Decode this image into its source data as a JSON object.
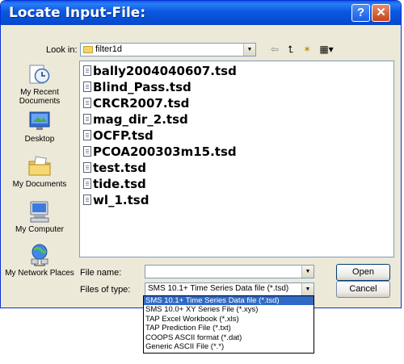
{
  "window": {
    "title": "Locate Input-File:"
  },
  "titlebar": {
    "help_glyph": "?",
    "close_glyph": "✕"
  },
  "toolbar": {
    "look_in_label": "Look in:",
    "look_in_value": "filter1d",
    "back_glyph": "⇦",
    "up_glyph": "⮤",
    "newfolder_glyph": "✶",
    "views_glyph": "▦▾"
  },
  "places": [
    {
      "label": "My Recent Documents",
      "icon": "recent-documents-icon"
    },
    {
      "label": "Desktop",
      "icon": "desktop-icon"
    },
    {
      "label": "My Documents",
      "icon": "my-documents-icon"
    },
    {
      "label": "My Computer",
      "icon": "my-computer-icon"
    },
    {
      "label": "My Network Places",
      "icon": "network-places-icon"
    }
  ],
  "files": [
    "bally2004040607.tsd",
    "Blind_Pass.tsd",
    "CRCR2007.tsd",
    "mag_dir_2.tsd",
    "OCFP.tsd",
    "PCOA200303m15.tsd",
    "test.tsd",
    "tide.tsd",
    "wl_1.tsd"
  ],
  "form": {
    "file_name_label": "File name:",
    "file_name_value": "",
    "file_type_label": "Files of type:",
    "file_type_value": "SMS 10.1+ Time Series Data file (*.tsd)"
  },
  "buttons": {
    "open": "Open",
    "cancel": "Cancel"
  },
  "filetype_options": [
    "SMS 10.1+ Time Series Data file (*.tsd)",
    "SMS 10.0+ XY Series File (*.xys)",
    "TAP Excel Workbook (*.xls)",
    "TAP Prediction File (*.txt)",
    "COOPS ASCII format (*.dat)",
    "Generic ASCII File (*.*)"
  ],
  "colors": {
    "titlebar": "#0a58e0",
    "selection": "#316ac5",
    "dialog_bg": "#ece9d8"
  }
}
